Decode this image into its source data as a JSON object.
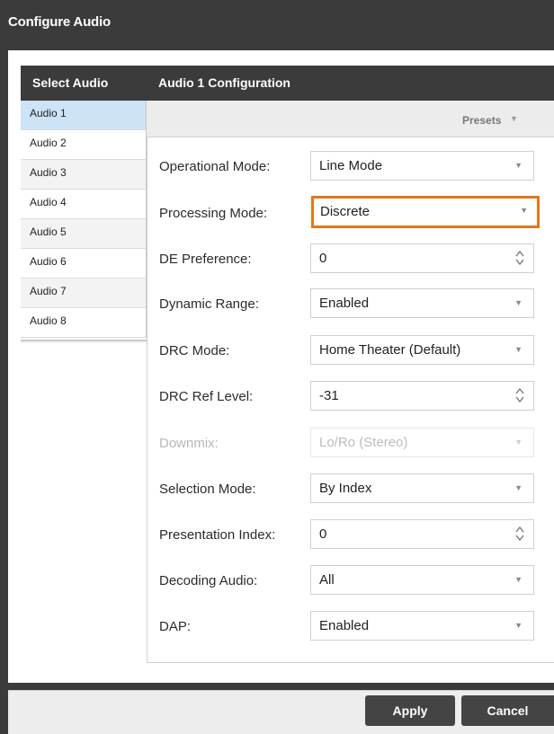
{
  "dialog": {
    "title": "Configure Audio"
  },
  "sidebar": {
    "header": "Select Audio",
    "selected_index": 0,
    "items": [
      {
        "label": "Audio 1"
      },
      {
        "label": "Audio 2"
      },
      {
        "label": "Audio 3"
      },
      {
        "label": "Audio 4"
      },
      {
        "label": "Audio 5"
      },
      {
        "label": "Audio 6"
      },
      {
        "label": "Audio 7"
      },
      {
        "label": "Audio 8"
      }
    ]
  },
  "config": {
    "header": "Audio 1 Configuration",
    "presets_label": "Presets",
    "fields": [
      {
        "label": "Operational Mode:",
        "value": "Line Mode",
        "control": "select",
        "enabled": true
      },
      {
        "label": "Processing Mode:",
        "value": "Discrete",
        "control": "select",
        "enabled": true,
        "focused": true
      },
      {
        "label": "DE Preference:",
        "value": "0",
        "control": "spinner",
        "enabled": true
      },
      {
        "label": "Dynamic Range:",
        "value": "Enabled",
        "control": "select",
        "enabled": true
      },
      {
        "label": "DRC Mode:",
        "value": "Home Theater (Default)",
        "control": "select",
        "enabled": true
      },
      {
        "label": "DRC Ref Level:",
        "value": "-31",
        "control": "spinner",
        "enabled": true
      },
      {
        "label": "Downmix:",
        "value": "Lo/Ro (Stereo)",
        "control": "select",
        "enabled": false
      },
      {
        "label": "Selection Mode:",
        "value": "By Index",
        "control": "select",
        "enabled": true
      },
      {
        "label": "Presentation Index:",
        "value": "0",
        "control": "spinner",
        "enabled": true
      },
      {
        "label": "Decoding Audio:",
        "value": "All",
        "control": "select",
        "enabled": true
      },
      {
        "label": "DAP:",
        "value": "Enabled",
        "control": "select",
        "enabled": true
      }
    ]
  },
  "footer": {
    "apply_label": "Apply",
    "cancel_label": "Cancel"
  },
  "icons": {
    "select_caret": "caret-down-icon",
    "spinner": "spinner-arrows-icon",
    "presets_caret": "caret-down-icon"
  },
  "colors": {
    "focus_highlight": "#e0781e",
    "selected_row": "#cde4f7",
    "header_bg": "#3b3b3b"
  }
}
